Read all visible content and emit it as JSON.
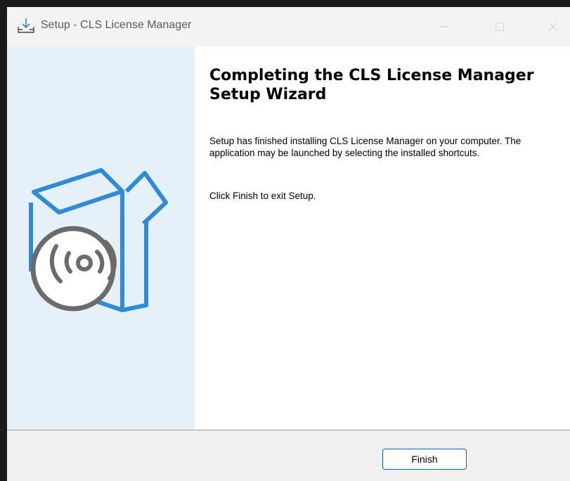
{
  "window": {
    "title": "Setup - CLS License Manager"
  },
  "icons": {
    "app": "installer-download-icon",
    "minimize": "minimize-icon",
    "maximize": "maximize-icon",
    "close": "close-icon",
    "product": "software-box-disc-icon"
  },
  "colors": {
    "sidebar_bg": "#e6f0f8",
    "box_stroke": "#2f8ad8",
    "disc_stroke": "#6b6b6b",
    "button_border": "#0067c0"
  },
  "content": {
    "heading": "Completing the CLS License Manager Setup Wizard",
    "paragraph1": "Setup has finished installing CLS License Manager on your computer. The application may be launched by selecting the installed shortcuts.",
    "paragraph2": "Click Finish to exit Setup."
  },
  "footer": {
    "finish_label": "Finish"
  }
}
